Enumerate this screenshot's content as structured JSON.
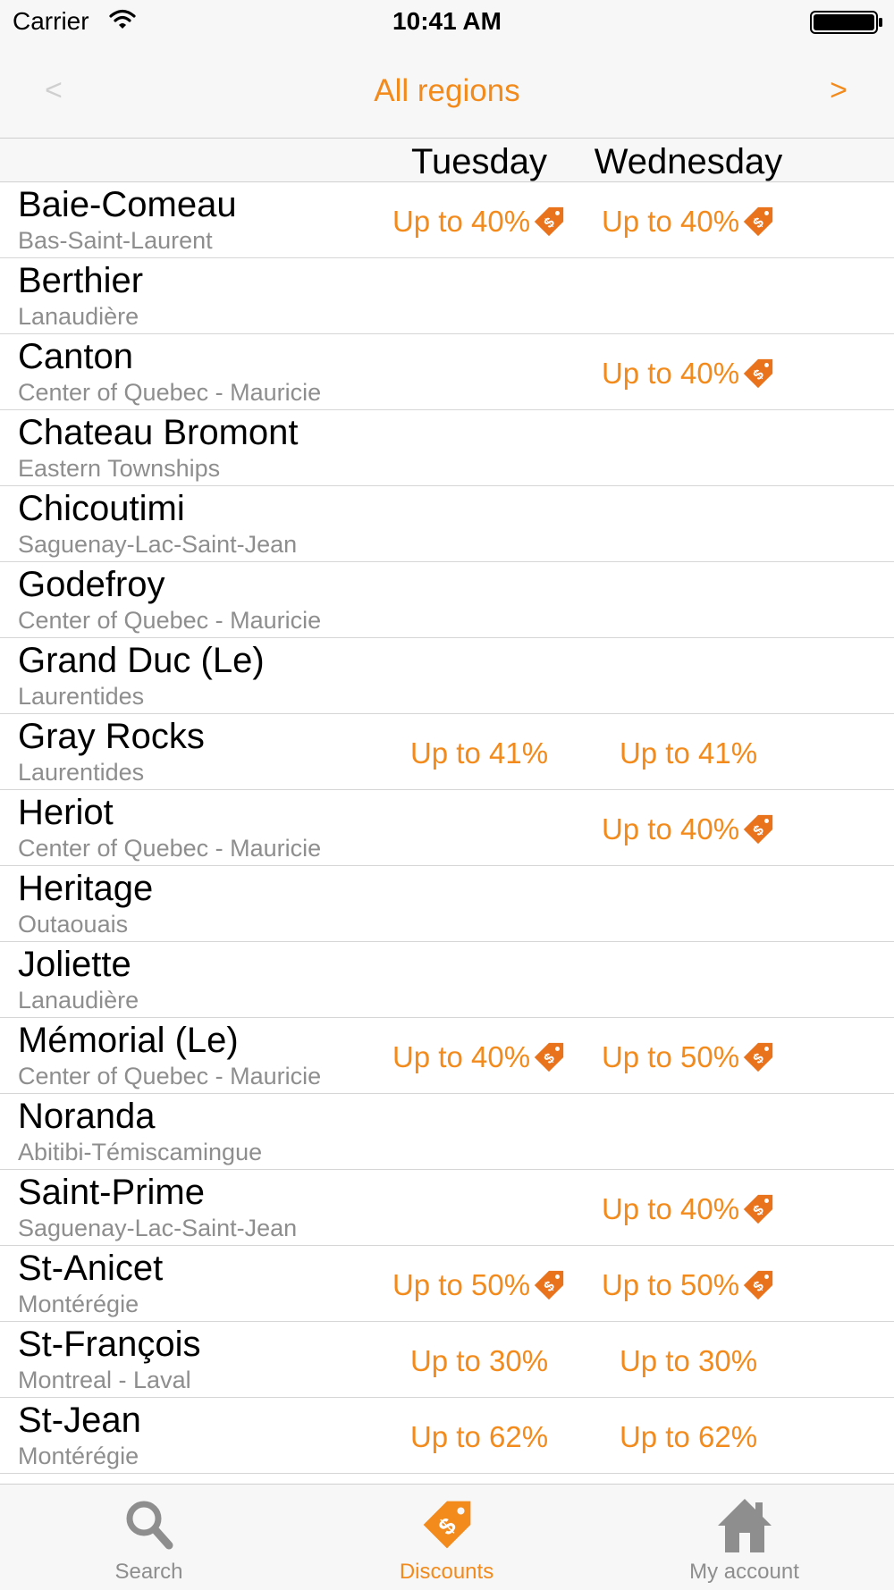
{
  "status_bar": {
    "carrier": "Carrier",
    "time": "10:41 AM"
  },
  "nav": {
    "title": "All regions",
    "prev": "<",
    "next": ">"
  },
  "days": [
    "Tuesday",
    "Wednesday"
  ],
  "rows": [
    {
      "name": "Baie-Comeau",
      "region": "Bas-Saint-Laurent",
      "tue": "Up to 40%",
      "tue_tag": true,
      "wed": "Up to 40%",
      "wed_tag": true
    },
    {
      "name": "Berthier",
      "region": "Lanaudière",
      "tue": "",
      "tue_tag": false,
      "wed": "",
      "wed_tag": false
    },
    {
      "name": "Canton",
      "region": "Center of Quebec - Mauricie",
      "tue": "",
      "tue_tag": false,
      "wed": "Up to 40%",
      "wed_tag": true
    },
    {
      "name": "Chateau Bromont",
      "region": "Eastern Townships",
      "tue": "",
      "tue_tag": false,
      "wed": "",
      "wed_tag": false
    },
    {
      "name": "Chicoutimi",
      "region": "Saguenay-Lac-Saint-Jean",
      "tue": "",
      "tue_tag": false,
      "wed": "",
      "wed_tag": false
    },
    {
      "name": "Godefroy",
      "region": "Center of Quebec - Mauricie",
      "tue": "",
      "tue_tag": false,
      "wed": "",
      "wed_tag": false
    },
    {
      "name": "Grand Duc (Le)",
      "region": "Laurentides",
      "tue": "",
      "tue_tag": false,
      "wed": "",
      "wed_tag": false
    },
    {
      "name": "Gray Rocks",
      "region": "Laurentides",
      "tue": "Up to 41%",
      "tue_tag": false,
      "wed": "Up to 41%",
      "wed_tag": false
    },
    {
      "name": "Heriot",
      "region": "Center of Quebec - Mauricie",
      "tue": "",
      "tue_tag": false,
      "wed": "Up to 40%",
      "wed_tag": true
    },
    {
      "name": "Heritage",
      "region": "Outaouais",
      "tue": "",
      "tue_tag": false,
      "wed": "",
      "wed_tag": false
    },
    {
      "name": "Joliette",
      "region": "Lanaudière",
      "tue": "",
      "tue_tag": false,
      "wed": "",
      "wed_tag": false
    },
    {
      "name": "Mémorial (Le)",
      "region": "Center of Quebec - Mauricie",
      "tue": "Up to 40%",
      "tue_tag": true,
      "wed": "Up to 50%",
      "wed_tag": true
    },
    {
      "name": "Noranda",
      "region": "Abitibi-Témiscamingue",
      "tue": "",
      "tue_tag": false,
      "wed": "",
      "wed_tag": false
    },
    {
      "name": "Saint-Prime",
      "region": "Saguenay-Lac-Saint-Jean",
      "tue": "",
      "tue_tag": false,
      "wed": "Up to 40%",
      "wed_tag": true
    },
    {
      "name": "St-Anicet",
      "region": "Montérégie",
      "tue": "Up to 50%",
      "tue_tag": true,
      "wed": "Up to 50%",
      "wed_tag": true
    },
    {
      "name": "St-François",
      "region": "Montreal - Laval",
      "tue": "Up to 30%",
      "tue_tag": false,
      "wed": "Up to 30%",
      "wed_tag": false
    },
    {
      "name": "St-Jean",
      "region": "Montérégie",
      "tue": "Up to 62%",
      "tue_tag": false,
      "wed": "Up to 62%",
      "wed_tag": false
    }
  ],
  "tabs": [
    {
      "label": "Search",
      "icon": "magnifier-icon",
      "active": false
    },
    {
      "label": "Discounts",
      "icon": "price-tag-icon",
      "active": true
    },
    {
      "label": "My account",
      "icon": "house-icon",
      "active": false
    }
  ],
  "colors": {
    "accent": "#f28a1c",
    "tag": "#e8731c",
    "inactive": "#8e8e8e",
    "bar_bg": "#f7f7f7"
  }
}
